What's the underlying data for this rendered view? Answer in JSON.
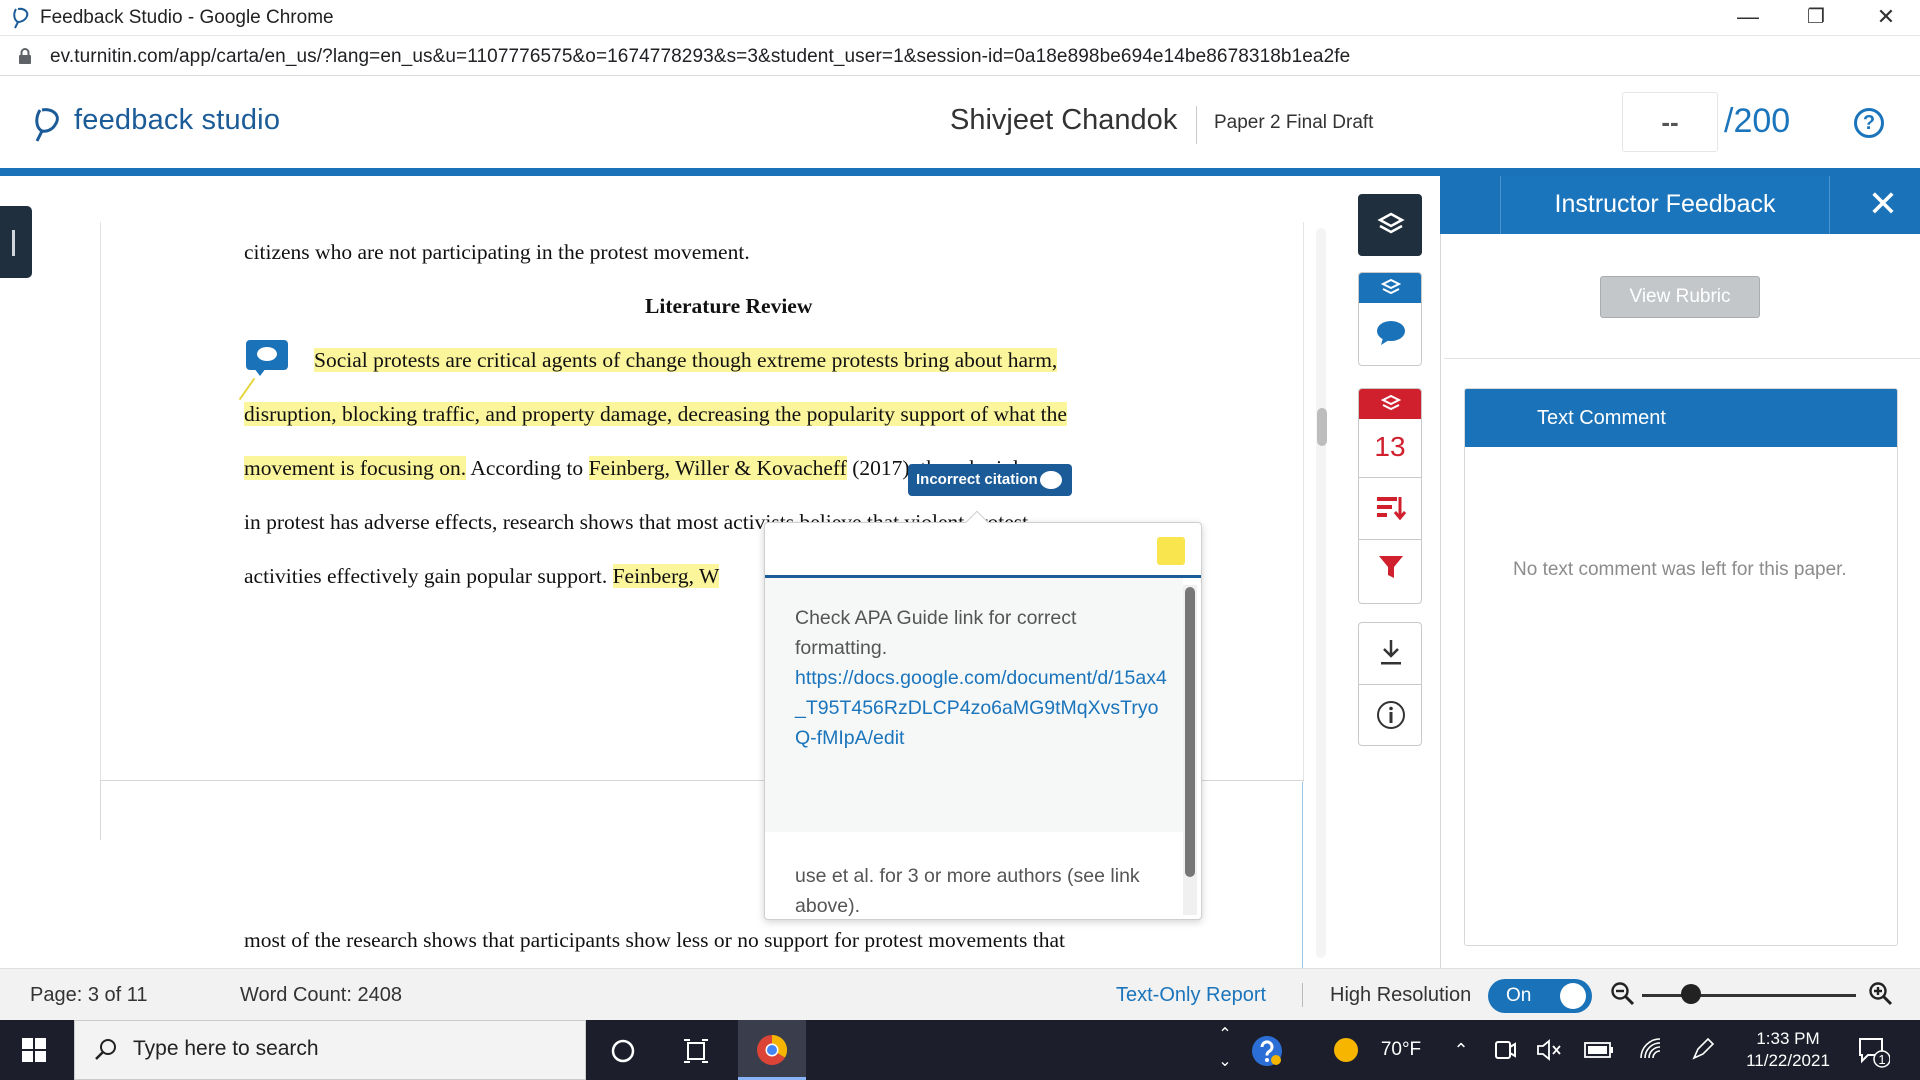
{
  "browser": {
    "window_title": "Feedback Studio - Google Chrome",
    "url": "ev.turnitin.com/app/carta/en_us/?lang=en_us&u=1107776575&o=1674778293&s=3&student_user=1&session-id=0a18e898be694e14be8678318b1ea2fe",
    "controls": {
      "minimize": "—",
      "restore": "❐",
      "close": "✕"
    }
  },
  "header": {
    "brand": "feedback studio",
    "student_name": "Shivjeet Chandok",
    "paper_title": "Paper 2 Final Draft",
    "score": "--",
    "score_max": "/200",
    "help_label": "?"
  },
  "document": {
    "lines": [
      {
        "text": "citizens who are not participating in the protest movement."
      },
      {
        "text": "Literature Review"
      },
      {
        "text": "Social protests are critical agents of change though extreme protests bring about harm,"
      },
      {
        "text": "disruption, blocking traffic, and property damage, decreasing the popularity support of what the"
      },
      {
        "seg1": "movement is focusing on.",
        "seg2": " According to ",
        "seg3": "Feinberg, Willer & Kovacheff",
        "seg4": " (2017), though violence"
      },
      {
        "text": "in protest has adverse effects, research shows that most activists believe that violent protest"
      },
      {
        "seg1": "activities effectively gain popular support. ",
        "seg2": "Feinberg, W"
      },
      {
        "text": "most of the research shows that participants show less or no support for protest movements that"
      }
    ]
  },
  "citation_chip": {
    "label": "Incorrect citation"
  },
  "popup": {
    "text1": "Check APA Guide link for correct formatting.",
    "link": "https://docs.google.com/document/d/15ax4_T95T456RzDLCP4zo6aMG9tMqXvsTryoQ-fMIpA/edit",
    "text2": "use et al. for 3 or more authors (see link above)."
  },
  "tool_rail": {
    "grading_count": "13"
  },
  "right_panel": {
    "title": "Instructor Feedback",
    "close": "✕",
    "view_rubric": "View Rubric",
    "text_comment_title": "Text Comment",
    "text_comment_message": "No text comment was left for this paper."
  },
  "status_bar": {
    "page": "Page: 3 of 11",
    "word_count": "Word Count: 2408",
    "text_only_report": "Text-Only Report",
    "high_resolution": "High Resolution",
    "toggle_state": "On",
    "zoom_level": 0.23
  },
  "taskbar": {
    "search_placeholder": "Type here to search",
    "weather": "70°F",
    "time": "1:33 PM",
    "date": "11/22/2021",
    "notification_count": "1"
  },
  "colors": {
    "brand_blue": "#1a72b8",
    "highlight": "#fbf59c",
    "error_red": "#d0202e",
    "rail_dark": "#1f2f3d"
  }
}
